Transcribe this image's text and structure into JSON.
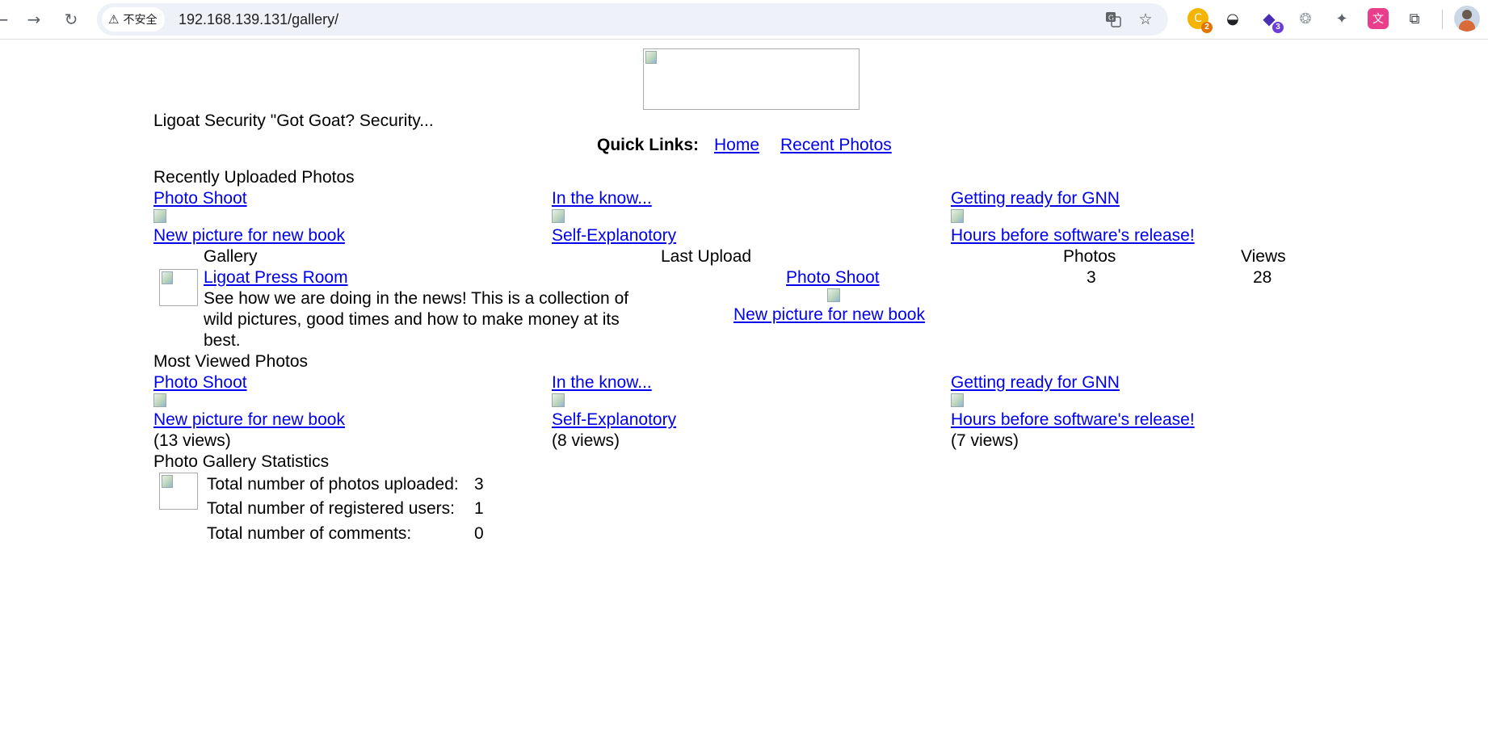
{
  "browser": {
    "security_label": "不安全",
    "url": "192.168.139.131/gallery/",
    "extensions": [
      {
        "name": "ext-1",
        "badge": "2",
        "color": "#f4b400",
        "badge_color": "#e37400"
      },
      {
        "name": "ext-2",
        "badge": "",
        "color": "#3c4043",
        "badge_color": ""
      },
      {
        "name": "ext-3",
        "badge": "3",
        "color": "#4a2fb5",
        "badge_color": "#6b3fd6"
      },
      {
        "name": "ext-4",
        "badge": "",
        "color": "#9aa0a6",
        "badge_color": ""
      },
      {
        "name": "ext-5",
        "badge": "",
        "color": "#5f6368",
        "badge_color": ""
      },
      {
        "name": "ext-6",
        "badge": "",
        "color": "#e83e8c",
        "badge_color": ""
      }
    ]
  },
  "page": {
    "site_title": "Ligoat Security \"Got Goat? Security...",
    "quick_links_label": "Quick Links:",
    "quick_links": [
      "Home",
      "Recent Photos"
    ],
    "recent": {
      "heading": "Recently Uploaded Photos",
      "items": [
        {
          "title": "Photo Shoot",
          "caption": "New picture for new book"
        },
        {
          "title": "In the know...",
          "caption": "Self-Explanotory"
        },
        {
          "title": "Getting ready for GNN",
          "caption": "Hours before software's release!"
        }
      ]
    },
    "gallery_table": {
      "headers": [
        "Gallery",
        "Last Upload",
        "Photos",
        "Views"
      ],
      "rows": [
        {
          "name": "Ligoat Press Room",
          "description": "See how we are doing in the news! This is a collection of wild pictures, good times and how to make money at its best.",
          "last_upload_title": "Photo Shoot",
          "last_upload_caption": "New picture for new book",
          "photos": "3",
          "views": "28"
        }
      ]
    },
    "most_viewed": {
      "heading": "Most Viewed Photos",
      "items": [
        {
          "title": "Photo Shoot",
          "caption": "New picture for new book",
          "views": "(13 views)"
        },
        {
          "title": "In the know...",
          "caption": "Self-Explanotory",
          "views": "(8 views)"
        },
        {
          "title": "Getting ready for GNN",
          "caption": "Hours before software's release!",
          "views": "(7 views)"
        }
      ]
    },
    "stats": {
      "heading": "Photo Gallery Statistics",
      "rows": [
        {
          "label": "Total number of photos uploaded:",
          "value": "3"
        },
        {
          "label": "Total number of registered users:",
          "value": "1"
        },
        {
          "label": "Total number of comments:",
          "value": "0"
        }
      ]
    }
  }
}
